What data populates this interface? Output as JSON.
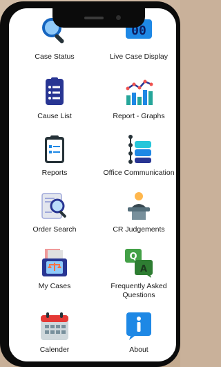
{
  "menu": [
    {
      "label": "Case Status",
      "icon": "search-icon"
    },
    {
      "label": "Live Case Display",
      "icon": "digital-display-icon"
    },
    {
      "label": "Cause List",
      "icon": "list-document-icon"
    },
    {
      "label": "Report - Graphs",
      "icon": "bar-graph-icon"
    },
    {
      "label": "Reports",
      "icon": "clipboard-icon"
    },
    {
      "label": "Office Communication",
      "icon": "flow-chart-icon"
    },
    {
      "label": "Order Search",
      "icon": "document-search-icon"
    },
    {
      "label": "CR Judgements",
      "icon": "speaker-podium-icon"
    },
    {
      "label": "My Cases",
      "icon": "law-tray-icon"
    },
    {
      "label": "Frequently Asked Questions",
      "icon": "qa-chat-icon"
    },
    {
      "label": "Calender",
      "icon": "calendar-icon"
    },
    {
      "label": "About",
      "icon": "info-icon"
    }
  ],
  "colors": {
    "accent_blue": "#1e88e5",
    "navy": "#283593",
    "teal": "#26a69a"
  }
}
